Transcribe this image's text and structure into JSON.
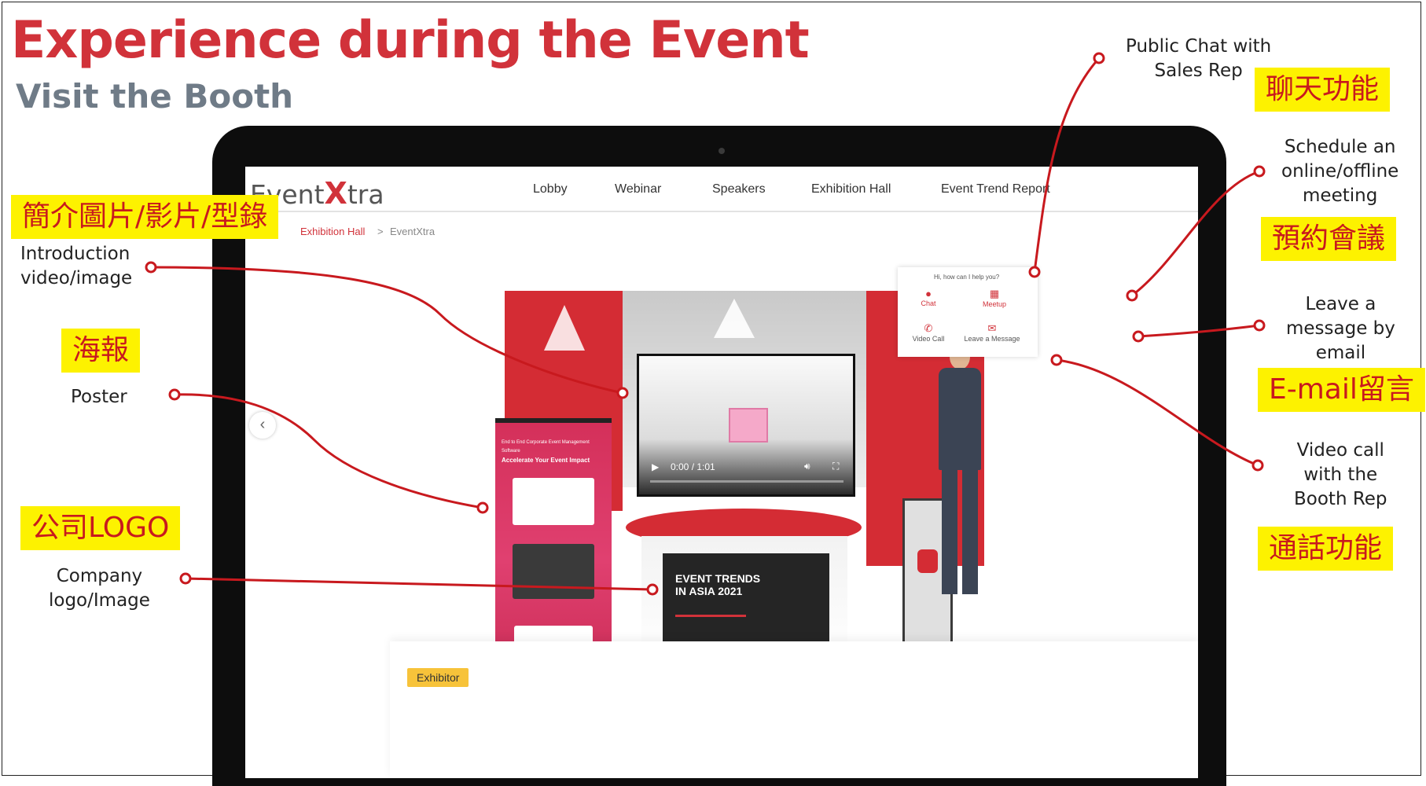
{
  "slide": {
    "title": "Experience during the Event",
    "subtitle": "Visit the Booth"
  },
  "annotations": {
    "intro_tag": "簡介圖片/影片/型錄",
    "intro_label": "Introduction\nvideo/image",
    "poster_tag": "海報",
    "poster_label": "Poster",
    "logo_tag": "公司LOGO",
    "logo_label": "Company\nlogo/Image",
    "chat_label": "Public Chat with\nSales Rep",
    "chat_tag": "聊天功能",
    "meeting_label": "Schedule an\nonline/offline\nmeeting",
    "meeting_tag": "預約會議",
    "message_label": "Leave a\nmessage by\nemail",
    "message_tag": "E-mail留言",
    "call_label": "Video call\nwith the\nBooth Rep",
    "call_tag": "通話功能"
  },
  "app": {
    "logo_left": "Event",
    "logo_x": "X",
    "logo_right": "tra",
    "nav": [
      "Lobby",
      "Webinar",
      "Speakers",
      "Exhibition Hall",
      "Event Trend Report"
    ],
    "breadcrumb": {
      "parent": "Exhibition Hall",
      "separator": ">",
      "current": "EventXtra"
    },
    "video": {
      "time": "0:00 / 1:01"
    },
    "poster": {
      "small": "End to End Corporate Event Management Software",
      "headline": "Accelerate Your Event Impact"
    },
    "counter_screen": "EVENT TRENDS IN ASIA 2021",
    "widget": {
      "prompt": "Hi, how can I help you?",
      "chat": "Chat",
      "meetup": "Meetup",
      "video_call": "Video Call",
      "leave_message": "Leave a Message"
    },
    "exhibitor_badge": "Exhibitor"
  },
  "colors": {
    "brand_red": "#d1323a",
    "tag_yellow": "#fdf200",
    "subtitle_gray": "#6f7b87"
  }
}
